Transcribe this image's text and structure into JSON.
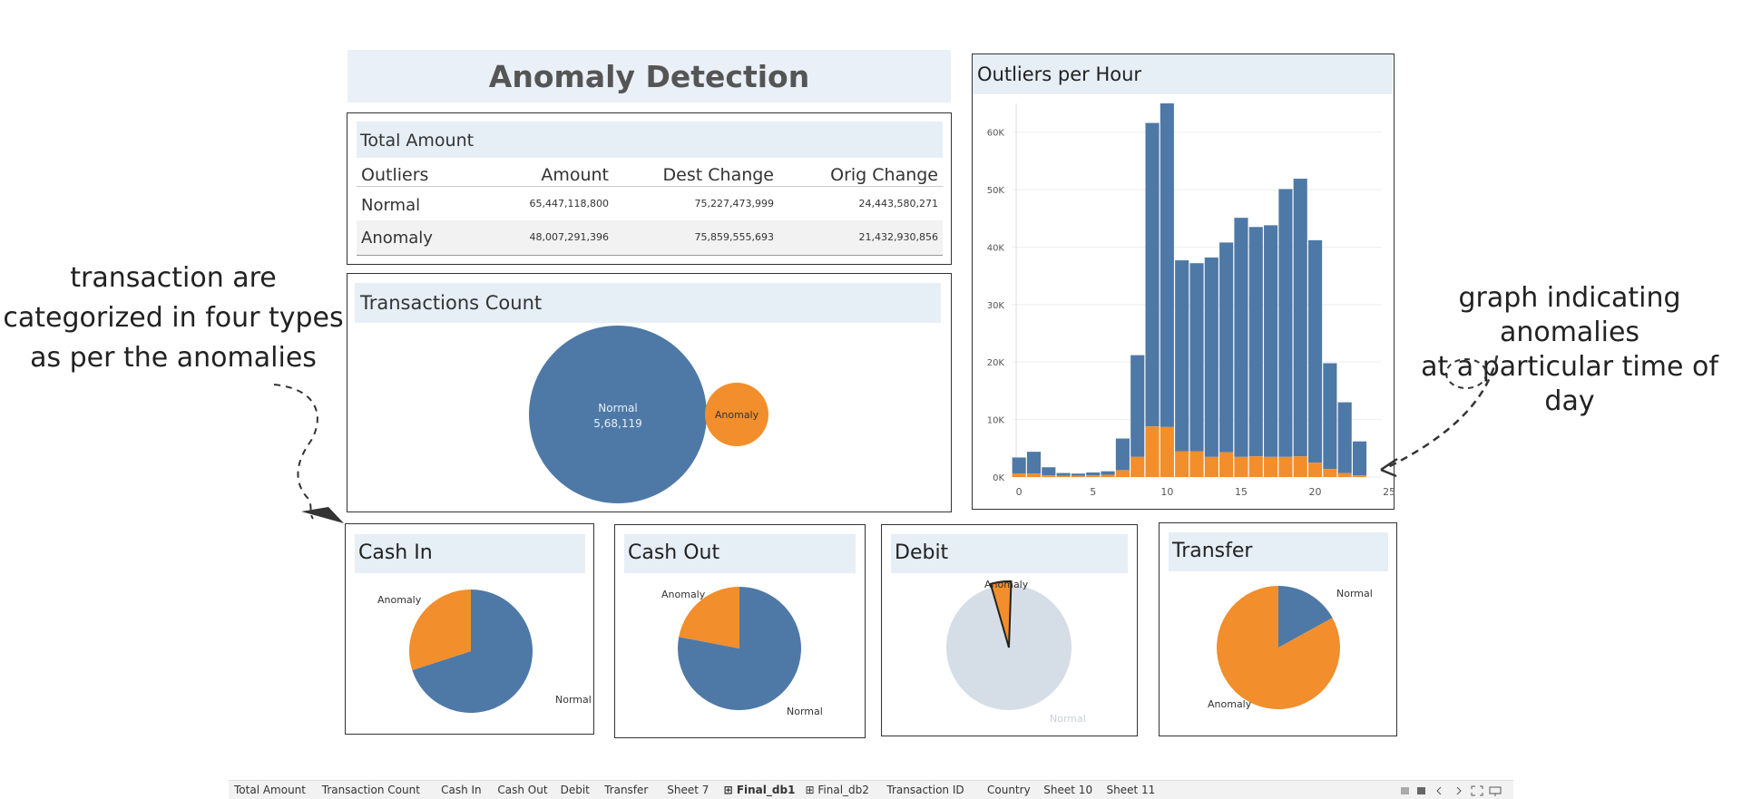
{
  "dashboard": {
    "title": "Anomaly Detection"
  },
  "colors": {
    "normal": "#4e79a7",
    "anomaly": "#f28e2b",
    "debit_normal": "#d5dee6",
    "header_bg": "#e6eef6"
  },
  "total_amount": {
    "title": "Total Amount",
    "columns": [
      "Outliers",
      "Amount",
      "Dest Change",
      "Orig Change"
    ],
    "rows": [
      {
        "label": "Normal",
        "amount": "65,447,118,800",
        "dest": "75,227,473,999",
        "orig": "24,443,580,271"
      },
      {
        "label": "Anomaly",
        "amount": "48,007,291,396",
        "dest": "75,859,555,693",
        "orig": "21,432,930,856"
      }
    ]
  },
  "transactions_count": {
    "title": "Transactions Count",
    "normal_label": "Normal",
    "normal_value": "5,68,119",
    "anomaly_label": "Anomaly"
  },
  "outliers_per_hour": {
    "title": "Outliers per Hour"
  },
  "chart_data": {
    "type": "bar",
    "title": "Outliers per Hour",
    "x": [
      0,
      1,
      2,
      3,
      4,
      5,
      6,
      7,
      8,
      9,
      10,
      11,
      12,
      13,
      14,
      15,
      16,
      17,
      18,
      19,
      20,
      21,
      22,
      23
    ],
    "xticks": [
      "0",
      "5",
      "10",
      "15",
      "20",
      "25"
    ],
    "yticks": [
      "0K",
      "10K",
      "20K",
      "30K",
      "40K",
      "50K",
      "60K"
    ],
    "ylim": [
      0,
      65000
    ],
    "xlim": [
      -0.5,
      24.5
    ],
    "stacked": true,
    "grid": true,
    "series": [
      {
        "name": "Anomaly",
        "values": [
          600,
          600,
          300,
          200,
          200,
          300,
          400,
          1200,
          3500,
          8800,
          8700,
          4500,
          4500,
          3500,
          4300,
          3500,
          3600,
          3500,
          3500,
          3600,
          2500,
          1400,
          700,
          300
        ]
      },
      {
        "name": "Normal",
        "values": [
          2800,
          3800,
          1400,
          500,
          400,
          500,
          600,
          5500,
          17700,
          52800,
          56300,
          33200,
          32700,
          34700,
          36500,
          41600,
          39900,
          40300,
          46600,
          48300,
          38700,
          18400,
          12300,
          5900
        ]
      }
    ]
  },
  "pies": [
    {
      "title": "Cash In",
      "labels": [
        "Anomaly",
        "Normal"
      ],
      "anomaly_fraction": 0.3
    },
    {
      "title": "Cash Out",
      "labels": [
        "Anomaly",
        "Normal"
      ],
      "anomaly_fraction": 0.22
    },
    {
      "title": "Debit",
      "labels": [
        "Anomaly",
        "Normal"
      ],
      "anomaly_fraction": 0.05
    },
    {
      "title": "Transfer",
      "labels": [
        "Normal",
        "Anomaly"
      ],
      "anomaly_fraction": 0.83
    }
  ],
  "annotations": {
    "left": [
      "transaction are",
      "categorized in four types",
      "as per the anomalies"
    ],
    "right": [
      "graph indicating anomalies",
      "at a particular time of day"
    ]
  },
  "sheet_tabs": [
    "Total Amount",
    "Transaction Count",
    "Cash In",
    "Cash Out",
    "Debit",
    "Transfer",
    "Sheet 7",
    "Final_db1",
    "Final_db2",
    "Transaction ID",
    "Country",
    "Sheet 10",
    "Sheet 11"
  ],
  "active_tab": "Final_db1"
}
